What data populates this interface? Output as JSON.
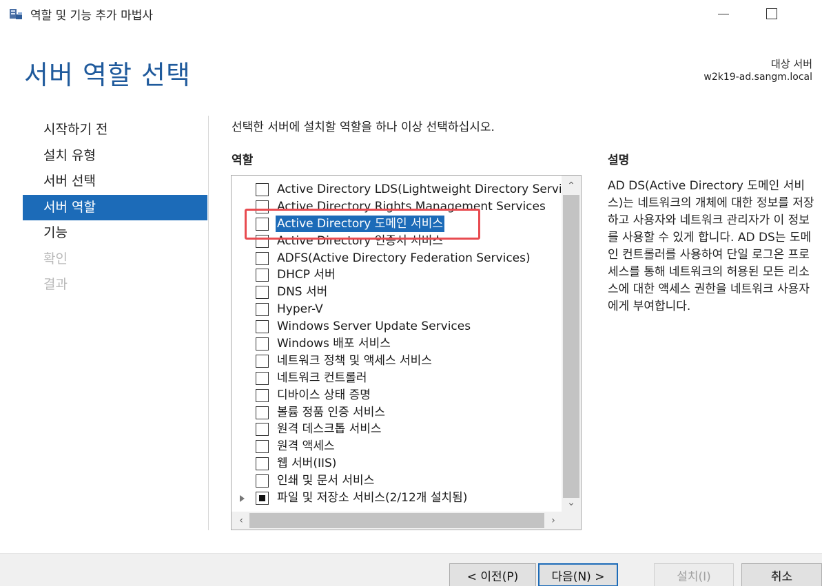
{
  "window": {
    "title": "역할 및 기능 추가 마법사"
  },
  "header": {
    "page_title": "서버 역할 선택",
    "target_label": "대상 서버",
    "target_server": "w2k19-ad.sangm.local"
  },
  "nav": {
    "items": [
      {
        "label": "시작하기 전",
        "state": "normal"
      },
      {
        "label": "설치 유형",
        "state": "normal"
      },
      {
        "label": "서버 선택",
        "state": "normal"
      },
      {
        "label": "서버 역할",
        "state": "active"
      },
      {
        "label": "기능",
        "state": "normal"
      },
      {
        "label": "확인",
        "state": "disabled"
      },
      {
        "label": "결과",
        "state": "disabled"
      }
    ]
  },
  "main": {
    "instruction": "선택한 서버에 설치할 역할을 하나 이상 선택하십시오.",
    "roles_heading": "역할",
    "description_heading": "설명",
    "description": "AD DS(Active Directory 도메인 서비스)는 네트워크의 개체에 대한 정보를 저장하고 사용자와 네트워크 관리자가 이 정보를 사용할 수 있게 합니다. AD DS는 도메인 컨트롤러를 사용하여 단일 로그온 프로세스를 통해 네트워크의 허용된 모든 리소스에 대한 액세스 권한을 네트워크 사용자에게 부여합니다.",
    "roles": [
      {
        "label": "Active Directory LDS(Lightweight Directory Services)",
        "checked": "false"
      },
      {
        "label": "Active Directory Rights Management Services",
        "checked": "false"
      },
      {
        "label": "Active Directory 도메인 서비스",
        "checked": "false",
        "selected": "true"
      },
      {
        "label": "Active Directory 인증서 서비스",
        "checked": "false"
      },
      {
        "label": "ADFS(Active Directory Federation Services)",
        "checked": "false"
      },
      {
        "label": "DHCP 서버",
        "checked": "false"
      },
      {
        "label": "DNS 서버",
        "checked": "false"
      },
      {
        "label": "Hyper-V",
        "checked": "false"
      },
      {
        "label": "Windows Server Update Services",
        "checked": "false"
      },
      {
        "label": "Windows 배포 서비스",
        "checked": "false"
      },
      {
        "label": "네트워크 정책 및 액세스 서비스",
        "checked": "false"
      },
      {
        "label": "네트워크 컨트롤러",
        "checked": "false"
      },
      {
        "label": "디바이스 상태 증명",
        "checked": "false"
      },
      {
        "label": "볼륨 정품 인증 서비스",
        "checked": "false"
      },
      {
        "label": "원격 데스크톱 서비스",
        "checked": "false"
      },
      {
        "label": "원격 액세스",
        "checked": "false"
      },
      {
        "label": "웹 서버(IIS)",
        "checked": "false"
      },
      {
        "label": "인쇄 및 문서 서비스",
        "checked": "false"
      },
      {
        "label": "파일 및 저장소 서비스(2/12개 설치됨)",
        "checked": "partial",
        "expandable": "true"
      }
    ]
  },
  "footer": {
    "prev_label": "< 이전(P)",
    "next_label": "다음(N) >",
    "install_label": "설치(I)",
    "cancel_label": "취소"
  },
  "colors": {
    "accent": "#1c6bb8",
    "title": "#1f5a9c",
    "highlight": "#e84b50"
  }
}
